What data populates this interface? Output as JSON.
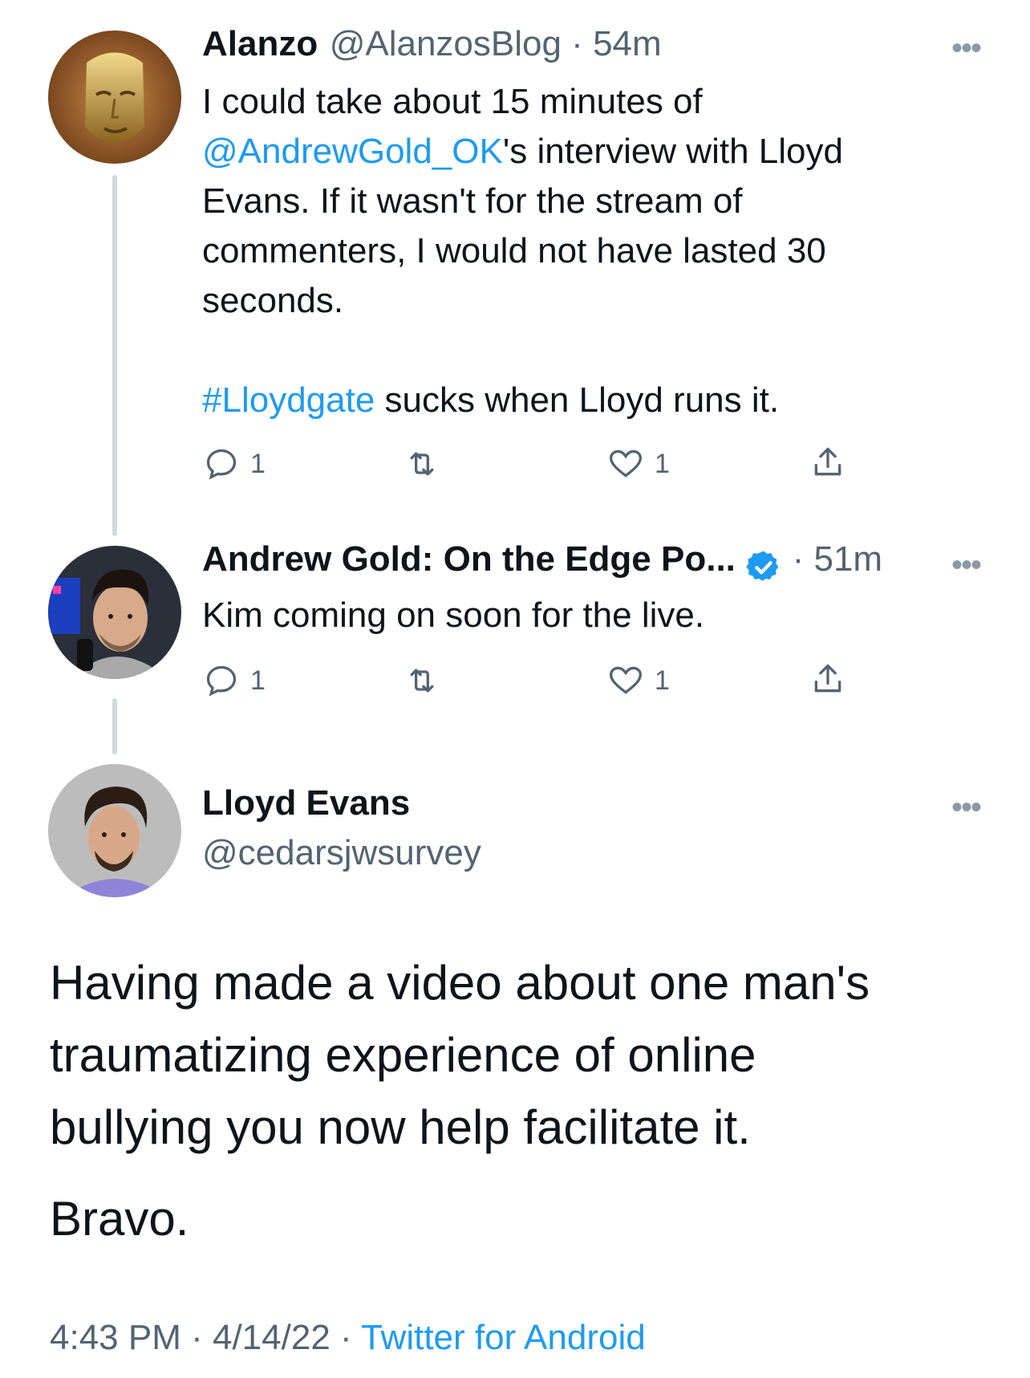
{
  "tweets": [
    {
      "display_name": "Alanzo",
      "handle": "@AlanzosBlog",
      "separator": " · ",
      "time": "54m",
      "text_parts": [
        "I could take about 15 minutes of\n",
        "@AndrewGold_OK",
        "'s interview with Lloyd\nEvans. If it wasn't for the stream of\ncommenters, I would not have lasted 30\nseconds.\n\n",
        "#Lloydgate",
        " sucks when Lloyd runs it."
      ],
      "reply_count": "1",
      "retweet_count": "",
      "like_count": "1"
    },
    {
      "display_name": "Andrew Gold: On the Edge Po...",
      "separator": " · ",
      "time": "51m",
      "text": "Kim coming on soon for the live.",
      "reply_count": "1",
      "retweet_count": "",
      "like_count": "1"
    }
  ],
  "main_tweet": {
    "display_name": "Lloyd Evans",
    "handle": "@cedarsjwsurvey",
    "text": "Having made a video about one man's\ntraumatizing experience of online\nbullying you now help facilitate it.",
    "text2": "Bravo.",
    "time": "4:43 PM",
    "sep1": " · ",
    "date": "4/14/22",
    "sep2": " · ",
    "source": "Twitter for Android"
  },
  "colors": {
    "accent": "#1d9bf0",
    "secondary_text": "#536471",
    "thread_line": "#cfd9de"
  },
  "icons": [
    "more-icon",
    "reply-icon",
    "retweet-icon",
    "like-icon",
    "share-icon",
    "verified-badge-icon"
  ]
}
